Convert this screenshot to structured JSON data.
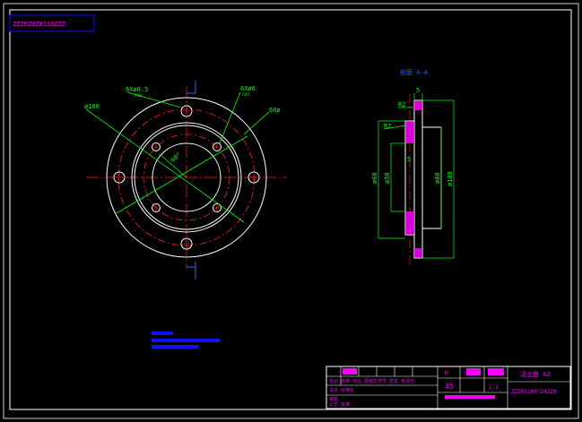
{
  "colors": {
    "background": "#000000",
    "frame": "#ffffff",
    "outline": "#ffffff",
    "center_line": "#ff2020",
    "dimension": "#00ff00",
    "annotation": "#ff00ff",
    "hatch": "#ff00ff",
    "stamp_blue": "#1010ff",
    "axis_blue": "#3060ff"
  },
  "corner_stamp": {
    "text": "ZZZ0Z0Z0110ZZZ"
  },
  "front_view": {
    "labels": {
      "hole_large": "6Xø8.5",
      "hole_large_note": "EQS",
      "hole_small": "6Xø6",
      "hole_small_note": "EQS",
      "hole_count": "6Xø",
      "outer_dia": "ø100",
      "angle": "60°"
    },
    "hole_count": 6
  },
  "section_view": {
    "title": "剖面 A-A",
    "labels": {
      "radius_top": "R2",
      "radius_mid": "R2",
      "thickness": "5",
      "step": "5",
      "dia_60": "ø60",
      "dia_50": "ø50",
      "dia_80": "ø80",
      "dia_108": "ø108"
    }
  },
  "title_block": {
    "drawing_name": "法兰盘 A3",
    "code": "ZZZ01100°24228",
    "material_label": "材",
    "material_value": "45",
    "scale_label": "比例",
    "scale_value": "1:1",
    "sheet_label": "共张",
    "weight_label": "重量",
    "rows": [
      "标记 处数 分区 更改文件号 签名 年月日",
      "设计 标准化",
      "审核",
      "工艺 批准"
    ]
  }
}
